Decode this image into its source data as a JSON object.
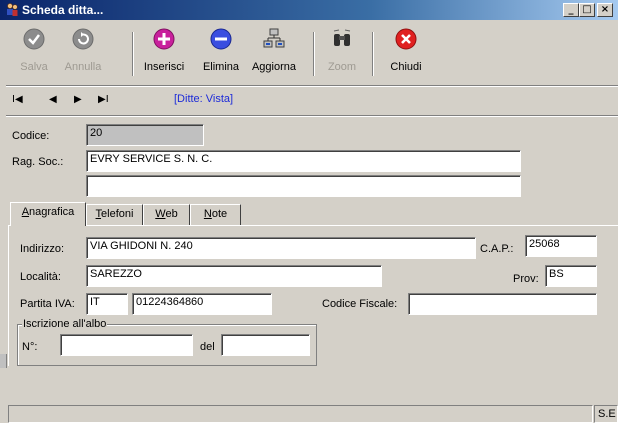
{
  "window": {
    "title": "Scheda ditta...",
    "controls": {
      "minimize": "_",
      "maximize": "□",
      "close": "×"
    }
  },
  "toolbar": {
    "salva": "Salva",
    "annulla": "Annulla",
    "inserisci": "Inserisci",
    "elimina": "Elimina",
    "aggiorna": "Aggiorna",
    "zoom": "Zoom",
    "chiudi": "Chiudi"
  },
  "nav": {
    "first": "I◀",
    "prev": "◀",
    "next": "▶",
    "last": "▶I",
    "status": "[Ditte: Vista]"
  },
  "header_form": {
    "codice_label": "Codice:",
    "codice_value": "20",
    "ragsoc_label": "Rag. Soc.:",
    "ragsoc_value": "EVRY SERVICE S. N. C.",
    "ragsoc2_value": ""
  },
  "tabs": [
    {
      "label": "Anagrafica",
      "accel": "A"
    },
    {
      "label": "Telefoni",
      "accel": "T"
    },
    {
      "label": "Web",
      "accel": "W"
    },
    {
      "label": "Note",
      "accel": "N"
    }
  ],
  "anagrafica": {
    "indirizzo_label": "Indirizzo:",
    "indirizzo_value": "VIA GHIDONI N. 240",
    "cap_label": "C.A.P.:",
    "cap_value": "25068",
    "localita_label": "Località:",
    "localita_value": "SAREZZO",
    "prov_label": "Prov:",
    "prov_value": "BS",
    "piva_label": "Partita IVA:",
    "piva_country": "IT",
    "piva_value": "01224364860",
    "cf_label": "Codice Fiscale:",
    "cf_value": "",
    "albo_group": "Iscrizione all'albo",
    "albo_num_label": "N°:",
    "albo_num_value": "",
    "albo_del_label": "del",
    "albo_del_value": ""
  },
  "statusbar": {
    "left": "",
    "right": "S.E"
  },
  "colors": {
    "title_start": "#0a246a",
    "title_end": "#a6caf0",
    "face": "#d4d0c8",
    "nav_status": "#1d2bd8"
  }
}
